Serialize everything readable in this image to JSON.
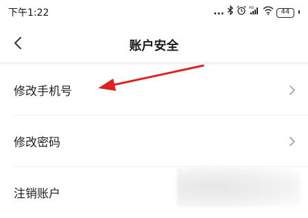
{
  "status_bar": {
    "time": "下午1:22",
    "icons": [
      "more-dots-icon",
      "bluetooth-icon",
      "alarm-icon",
      "hd-signal-icon",
      "wifi-icon",
      "battery-icon"
    ],
    "dots": "...",
    "battery_level": "44"
  },
  "nav": {
    "back_icon": "chevron-left-icon",
    "title": "账户安全"
  },
  "menu": {
    "items": [
      {
        "label": "修改手机号",
        "icon": "chevron-right-icon"
      },
      {
        "label": "修改密码",
        "icon": "chevron-right-icon"
      },
      {
        "label": "注销账户"
      }
    ]
  },
  "annotation": {
    "arrow_color": "#e02020",
    "points_to": "修改手机号"
  }
}
